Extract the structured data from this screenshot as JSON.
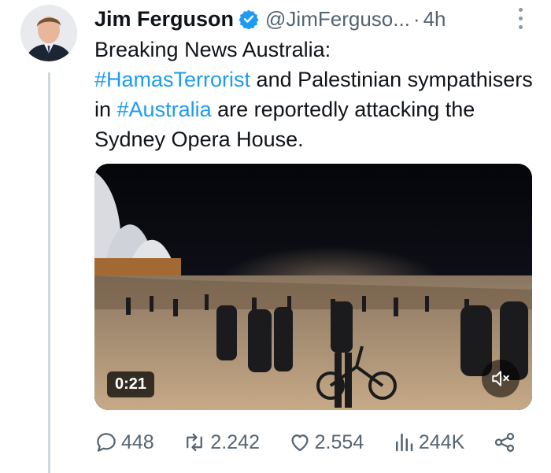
{
  "tweet": {
    "author_name": "Jim Ferguson",
    "handle": "@JimFerguso...",
    "separator": "·",
    "time": "4h",
    "verified_color": "#1d9bf0",
    "text_part1": "Breaking News Australia:",
    "hashtag1": "#HamasTerrorist",
    "text_part2": " and Palestinian sympathisers in ",
    "hashtag2": "#Australia",
    "text_part3": " are reportedly attacking the Sydney Opera House.",
    "hashtag_color": "#1d9bf0"
  },
  "media": {
    "type": "video",
    "duration": "0:21",
    "mute_icon": "speaker-muted-icon"
  },
  "actions": {
    "replies": "448",
    "reposts": "2.242",
    "likes": "2.554",
    "views": "244K"
  },
  "icons": {
    "reply": "reply-icon",
    "repost": "repost-icon",
    "like": "heart-icon",
    "views": "views-icon",
    "share": "share-icon",
    "more": "more-icon"
  }
}
